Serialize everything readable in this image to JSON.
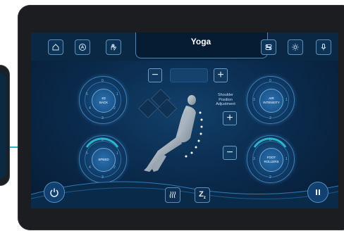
{
  "header": {
    "title": "Yoga"
  },
  "top_icons_left": [
    "home-icon",
    "auto-mode-icon",
    "hand-massage-icon"
  ],
  "top_icons_right": [
    "settings-toggle-icon",
    "light-icon",
    "microphone-icon"
  ],
  "dials": {
    "back": {
      "label_line1": "4D",
      "label_line2": "BACK",
      "numbers": [
        "0",
        "1",
        "2",
        "3",
        "4",
        "5"
      ]
    },
    "speed": {
      "label": "SPEED",
      "numbers": [
        "0",
        "1",
        "2",
        "3",
        "4",
        "5"
      ]
    },
    "air": {
      "label_line1": "AIR",
      "label_line2": "INTENSITY",
      "numbers": [
        "0",
        "1",
        "2",
        "3"
      ]
    },
    "foot": {
      "label_line1": "FOOT",
      "label_line2": "ROLLERS",
      "numbers": [
        "0",
        "1",
        "2",
        "3"
      ]
    }
  },
  "shoulder_adjust": {
    "line1": "Shoulder",
    "line2": "Position",
    "line3": "Adjustment"
  },
  "colors": {
    "accent": "#2ab6c9",
    "screen_bg": "#0b2c4f",
    "frame": "#1b1d21"
  },
  "bottom_icons": [
    "power-icon",
    "heat-icon",
    "sleep-icon",
    "pause-icon"
  ]
}
